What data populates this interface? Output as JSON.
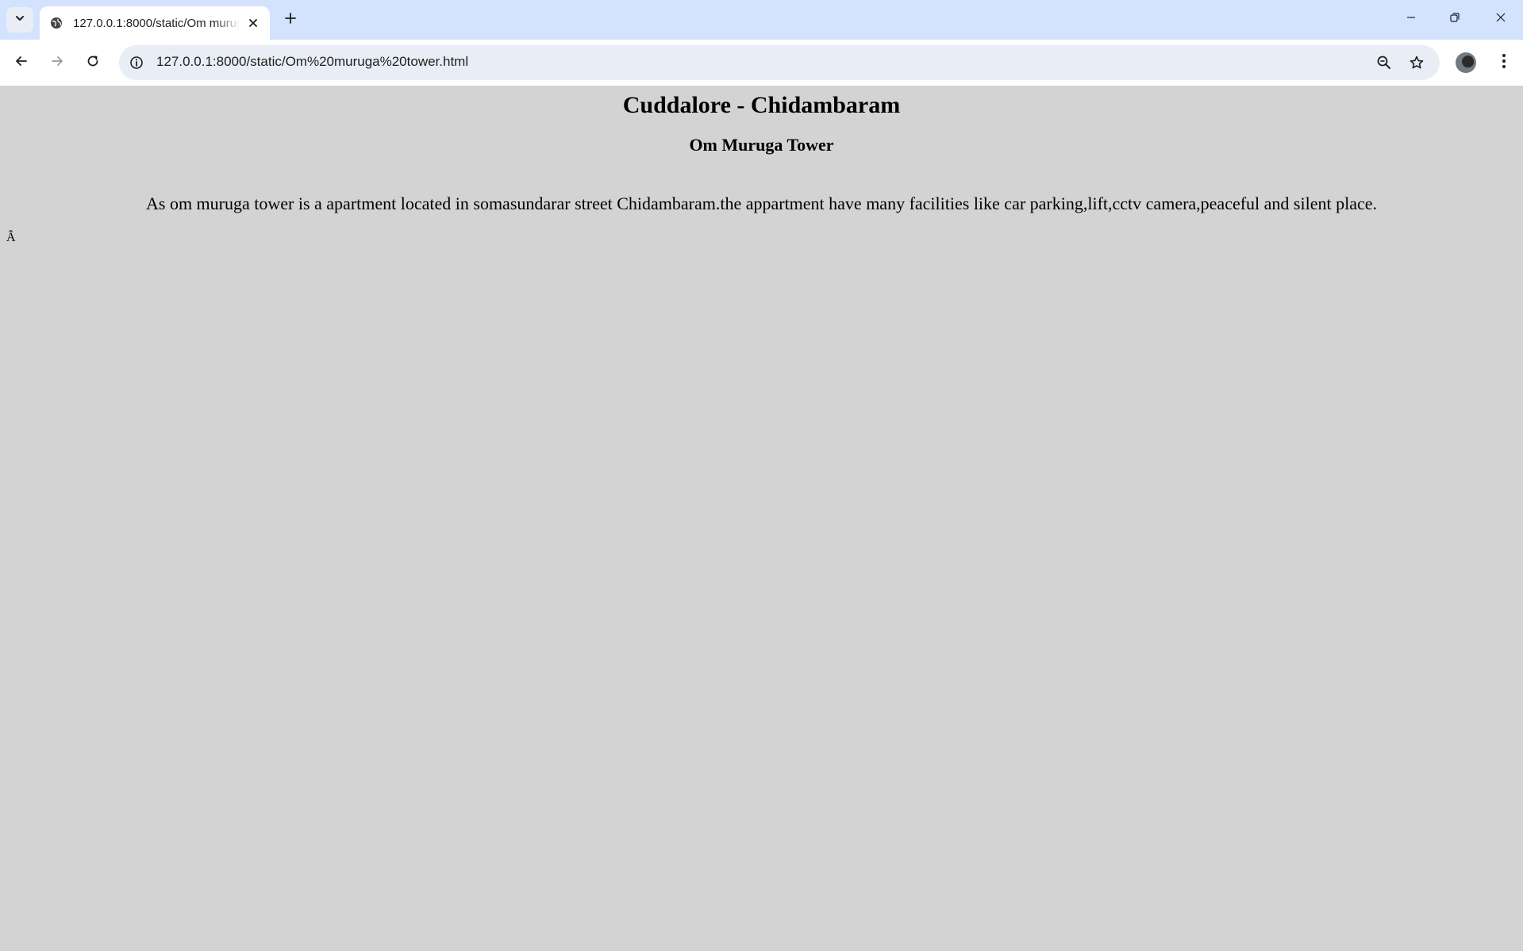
{
  "browser": {
    "tab": {
      "title": "127.0.0.1:8000/static/Om muruga tower.html"
    },
    "address_bar": {
      "url": "127.0.0.1:8000/static/Om%20muruga%20tower.html"
    },
    "icons": {
      "tab_search": "chevron-down-icon",
      "favicon": "globe-icon",
      "tab_close": "close-icon",
      "new_tab": "plus-icon",
      "minimize": "minimize-icon",
      "restore": "restore-icon",
      "close_window": "close-icon",
      "back": "arrow-left-icon",
      "forward": "arrow-right-icon",
      "reload": "reload-icon",
      "site_info": "info-icon",
      "zoom": "zoom-out-icon",
      "bookmark": "star-icon",
      "menu": "kebab-menu-icon"
    }
  },
  "page": {
    "title": "Cuddalore - Chidambaram",
    "subtitle": "Om Muruga Tower",
    "description": "As om muruga tower is a apartment located in somasundarar street Chidambaram.the appartment have many facilities like car parking,lift,cctv camera,peaceful and silent place.",
    "stray_char": "Â",
    "background_color": "#d3d3d3"
  }
}
